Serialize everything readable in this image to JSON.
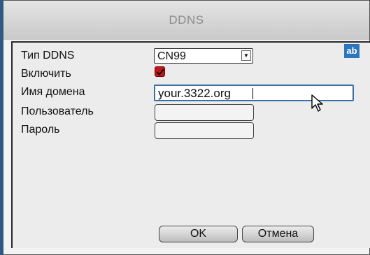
{
  "dialog": {
    "title": "DDNS"
  },
  "form": {
    "ddns_type_label": "Тип DDNS",
    "ddns_type_value": "CN99",
    "enable_label": "Включить",
    "enable_checked": true,
    "domain_label": "Имя домена",
    "domain_value": "your.3322.org",
    "user_label": "Пользователь",
    "user_value": "",
    "password_label": "Пароль",
    "password_value": "",
    "ime_badge": "ab"
  },
  "buttons": {
    "ok": "OK",
    "cancel": "Отмена"
  },
  "icons": {
    "dropdown": "chevron-down-icon",
    "cursor": "mouse-pointer-icon"
  },
  "colors": {
    "checkbox": "#c41616",
    "focus_border": "#3c6fa6",
    "ime_badge": "#2c76bf"
  }
}
